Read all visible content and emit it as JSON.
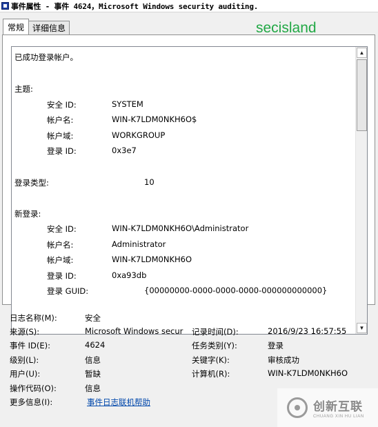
{
  "window": {
    "title": "事件属性 - 事件 4624，Microsoft Windows security auditing."
  },
  "tabs": [
    {
      "label": "常规",
      "active": true
    },
    {
      "label": "详细信息",
      "active": false
    }
  ],
  "watermark": "secisland",
  "description": {
    "lines": [
      "已成功登录帐户。",
      "主题:",
      "安全 ID:",
      "SYSTEM",
      "帐户名:",
      "WIN-K7LDM0NKH6O$",
      "帐户域:",
      "WORKGROUP",
      "登录 ID:",
      "0x3e7",
      "登录类型:",
      "10",
      "新登录:",
      "安全 ID:",
      "WIN-K7LDM0NKH6O\\Administrator",
      "帐户名:",
      "Administrator",
      "帐户域:",
      "WIN-K7LDM0NKH6O",
      "登录 ID:",
      "0xa93db",
      "登录 GUID:",
      "{00000000-0000-0000-0000-000000000000}"
    ]
  },
  "meta": {
    "log_name_label": "日志名称(M):",
    "log_name_value": "安全",
    "source_label": "来源(S):",
    "source_value": "Microsoft Windows secur",
    "logged_label": "记录时间(D):",
    "logged_value": "2016/9/23 16:57:55",
    "event_id_label": "事件 ID(E):",
    "event_id_value": "4624",
    "task_label": "任务类别(Y):",
    "task_value": "登录",
    "level_label": "级别(L):",
    "level_value": "信息",
    "keywords_label": "关键字(K):",
    "keywords_value": "审核成功",
    "user_label": "用户(U):",
    "user_value": "暂缺",
    "computer_label": "计算机(R):",
    "computer_value": "WIN-K7LDM0NKH6O",
    "opcode_label": "操作代码(O):",
    "opcode_value": "信息",
    "more_info_label": "更多信息(I):",
    "more_info_link": "事件日志联机帮助"
  },
  "brand": {
    "cn": "创新互联",
    "en": "CHUANG XIN HU LIAN"
  }
}
